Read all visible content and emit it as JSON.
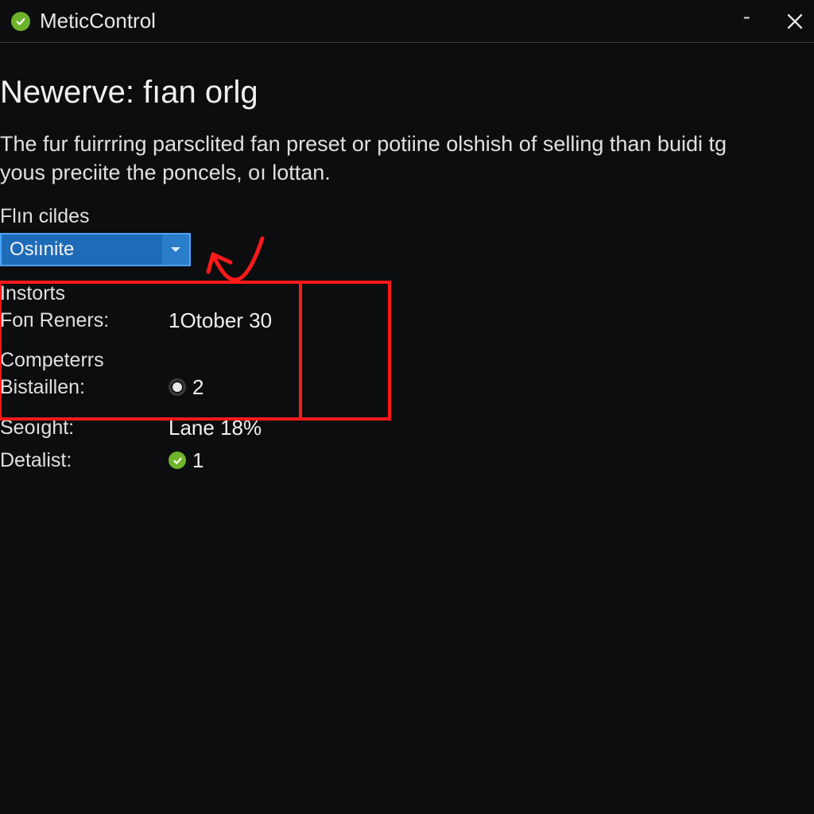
{
  "window": {
    "title": "MeticControl"
  },
  "page": {
    "title": "Newerve: fıan orlg",
    "description": "The fur fuirrring parsclited fan preset or potiine olshish of selling than buidi tg yous preciite the poncels, oı lottan."
  },
  "dropdown": {
    "label": "Flın cildes",
    "selected": "Osiınite"
  },
  "sections": {
    "instorts": {
      "header": "Instorts",
      "rows": {
        "for_reners": {
          "label": "Foп Reners:",
          "value": "1Otober 30"
        }
      }
    },
    "competercs": {
      "header": "Competerrs",
      "rows": {
        "bistaillen": {
          "label": "Bistaillen:",
          "value": "2"
        }
      }
    },
    "misc": {
      "rows": {
        "seoight": {
          "label": "Seoıght:",
          "value": "Lane 18%"
        },
        "detalist": {
          "label": "Detalist:",
          "value": "1"
        }
      }
    }
  },
  "annotation": {
    "color": "#ff1a1a"
  }
}
